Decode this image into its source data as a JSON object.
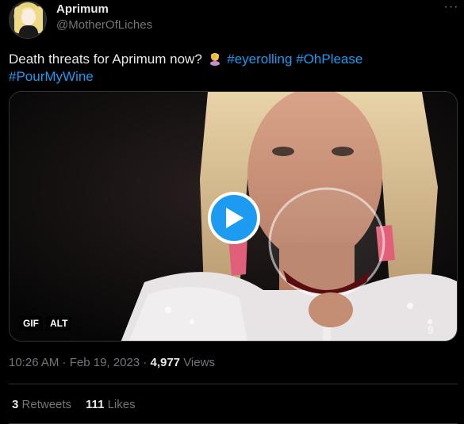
{
  "author": {
    "display_name": "Aprimum",
    "handle": "@MotherOfLiches"
  },
  "menu": {
    "more_label": "···"
  },
  "tweet": {
    "text": "Death threats for Aprimum now?",
    "emoji": "woman-facepalming",
    "hashtags": [
      "#eyerolling",
      "#OhPlease",
      "#PourMyWine"
    ]
  },
  "media": {
    "type": "gif",
    "badges": [
      "GIF",
      "ALT"
    ],
    "watermark": "9"
  },
  "meta": {
    "time": "10:26 AM",
    "date": "Feb 19, 2023",
    "views_count": "4,977",
    "views_label": "Views"
  },
  "stats": {
    "retweets_count": "3",
    "retweets_label": "Retweets",
    "likes_count": "111",
    "likes_label": "Likes"
  },
  "colors": {
    "background": "#000000",
    "accent": "#1d9bf0",
    "secondary_text": "#71767b",
    "divider": "#2f3336"
  }
}
